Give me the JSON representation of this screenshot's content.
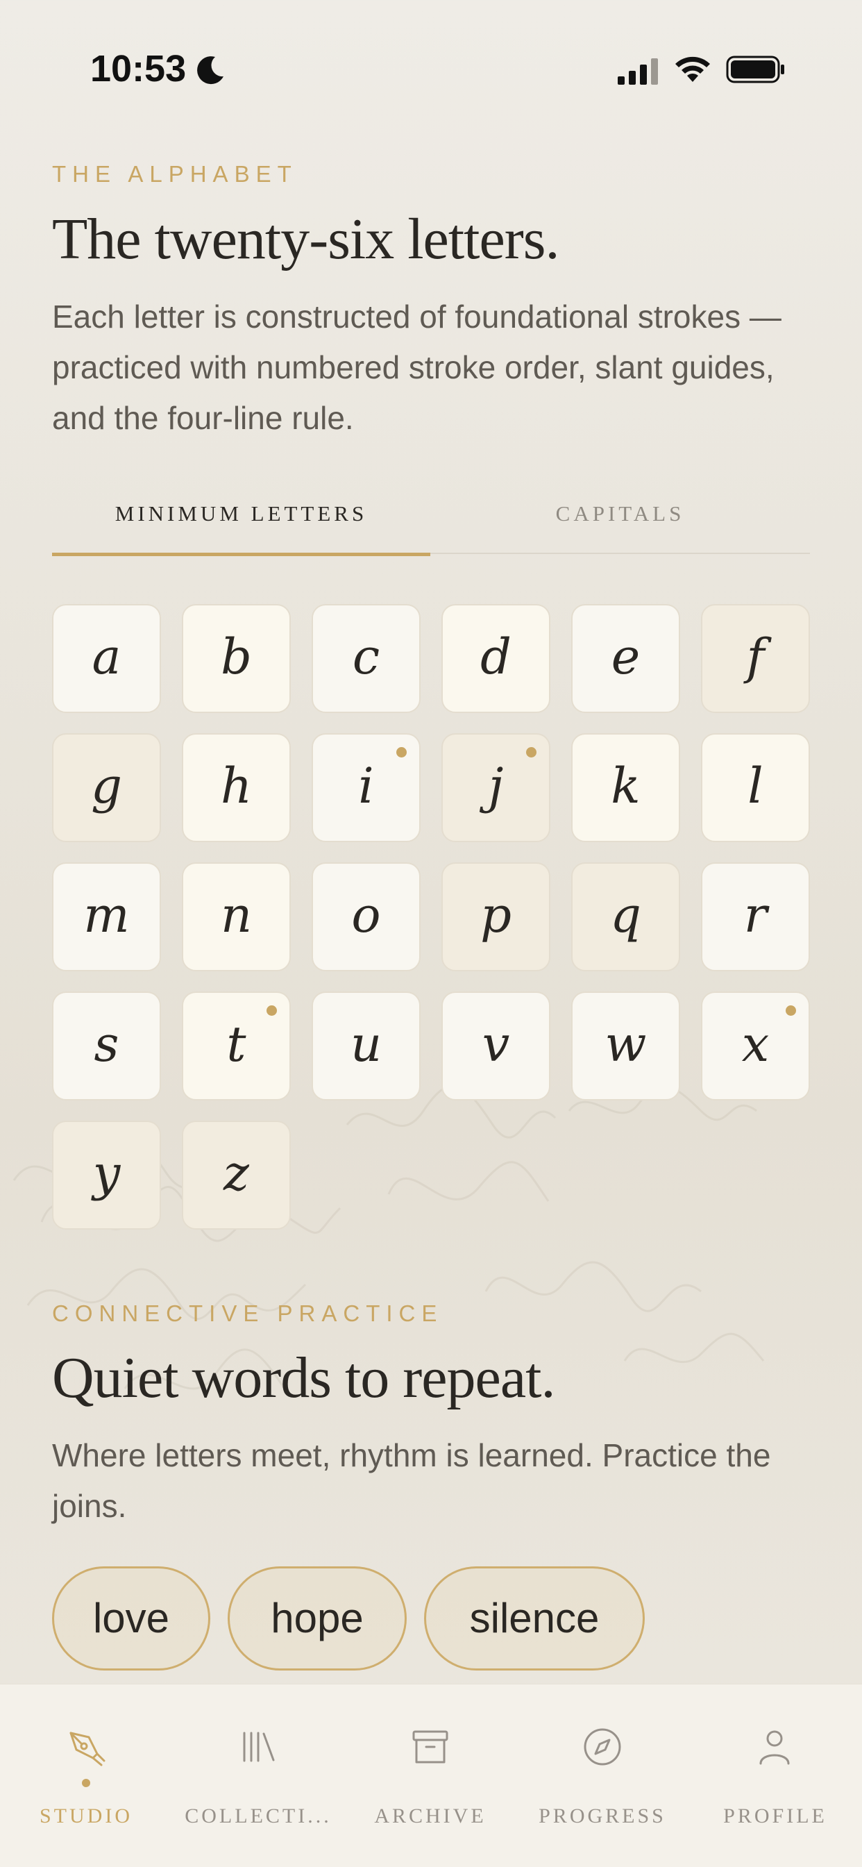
{
  "status_bar": {
    "time": "10:53"
  },
  "alphabet_section": {
    "eyebrow": "THE ALPHABET",
    "title": "The twenty-six letters.",
    "description": "Each letter is constructed of foundational strokes — practiced with numbered stroke order, slant guides, and the four-line rule."
  },
  "tabs": [
    {
      "label": "MINIMUM LETTERS",
      "active": true
    },
    {
      "label": "CAPITALS",
      "active": false
    }
  ],
  "letters": [
    {
      "char": "a",
      "style": "plain",
      "dot": false
    },
    {
      "char": "b",
      "style": "cream",
      "dot": false
    },
    {
      "char": "c",
      "style": "plain",
      "dot": false
    },
    {
      "char": "d",
      "style": "cream",
      "dot": false
    },
    {
      "char": "e",
      "style": "plain",
      "dot": false
    },
    {
      "char": "f",
      "style": "tan",
      "dot": false
    },
    {
      "char": "g",
      "style": "tan",
      "dot": false
    },
    {
      "char": "h",
      "style": "cream",
      "dot": false
    },
    {
      "char": "i",
      "style": "plain",
      "dot": true
    },
    {
      "char": "j",
      "style": "tan",
      "dot": true
    },
    {
      "char": "k",
      "style": "cream",
      "dot": false
    },
    {
      "char": "l",
      "style": "cream",
      "dot": false
    },
    {
      "char": "m",
      "style": "plain",
      "dot": false
    },
    {
      "char": "n",
      "style": "cream",
      "dot": false
    },
    {
      "char": "o",
      "style": "plain",
      "dot": false
    },
    {
      "char": "p",
      "style": "tan",
      "dot": false
    },
    {
      "char": "q",
      "style": "tan",
      "dot": false
    },
    {
      "char": "r",
      "style": "plain",
      "dot": false
    },
    {
      "char": "s",
      "style": "plain",
      "dot": false
    },
    {
      "char": "t",
      "style": "cream",
      "dot": true
    },
    {
      "char": "u",
      "style": "plain",
      "dot": false
    },
    {
      "char": "v",
      "style": "plain",
      "dot": false
    },
    {
      "char": "w",
      "style": "plain",
      "dot": false
    },
    {
      "char": "x",
      "style": "plain",
      "dot": true
    },
    {
      "char": "y",
      "style": "tan",
      "dot": false
    },
    {
      "char": "z",
      "style": "tan",
      "dot": false
    }
  ],
  "connective_section": {
    "eyebrow": "CONNECTIVE PRACTICE",
    "title": "Quiet words to repeat.",
    "description": "Where letters meet, rhythm is learned. Practice the joins."
  },
  "practice_words": [
    "love",
    "hope",
    "silence"
  ],
  "bottom_nav": [
    {
      "label": "STUDIO",
      "icon": "pen-nib-icon",
      "active": true
    },
    {
      "label": "COLLECTI...",
      "icon": "library-icon",
      "active": false
    },
    {
      "label": "ARCHIVE",
      "icon": "archive-box-icon",
      "active": false
    },
    {
      "label": "PROGRESS",
      "icon": "compass-icon",
      "active": false
    },
    {
      "label": "PROFILE",
      "icon": "person-icon",
      "active": false
    }
  ],
  "colors": {
    "accent_gold": "#c9a663",
    "ink": "#2a2723",
    "muted_text": "#5f5a53",
    "nav_inactive": "#97918a"
  }
}
